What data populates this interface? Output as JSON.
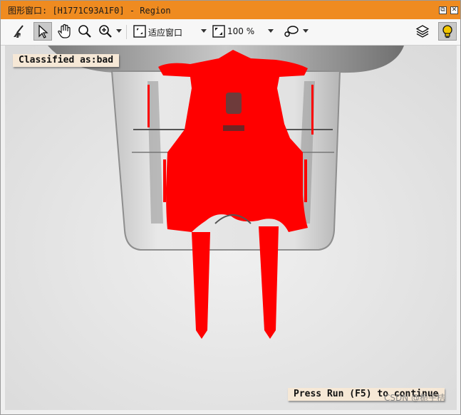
{
  "window": {
    "title": "图形窗口: [H1771C93A1F0] - Region",
    "restore_glyph": "⧉",
    "close_glyph": "✕"
  },
  "toolbar": {
    "tools": [
      {
        "name": "clear-tool",
        "icon": "broom-icon"
      },
      {
        "name": "pointer-tool",
        "icon": "cursor-icon",
        "active": true
      },
      {
        "name": "pan-tool",
        "icon": "hand-icon"
      },
      {
        "name": "zoom-tool",
        "icon": "magnifier-icon"
      },
      {
        "name": "zoom-in-tool",
        "icon": "zoom-in-icon"
      }
    ],
    "fit_label": "适应窗口",
    "zoom_label": "100 %",
    "draw_icon": "lasso-icon",
    "layers_icon": "layers-icon",
    "tips_icon": "lightbulb-icon"
  },
  "canvas": {
    "classification": "Classified as:bad",
    "continue_hint": "Press Run (F5) to continue",
    "region_color": "#ff0000"
  },
  "watermark": "CSDN @栀子桔"
}
